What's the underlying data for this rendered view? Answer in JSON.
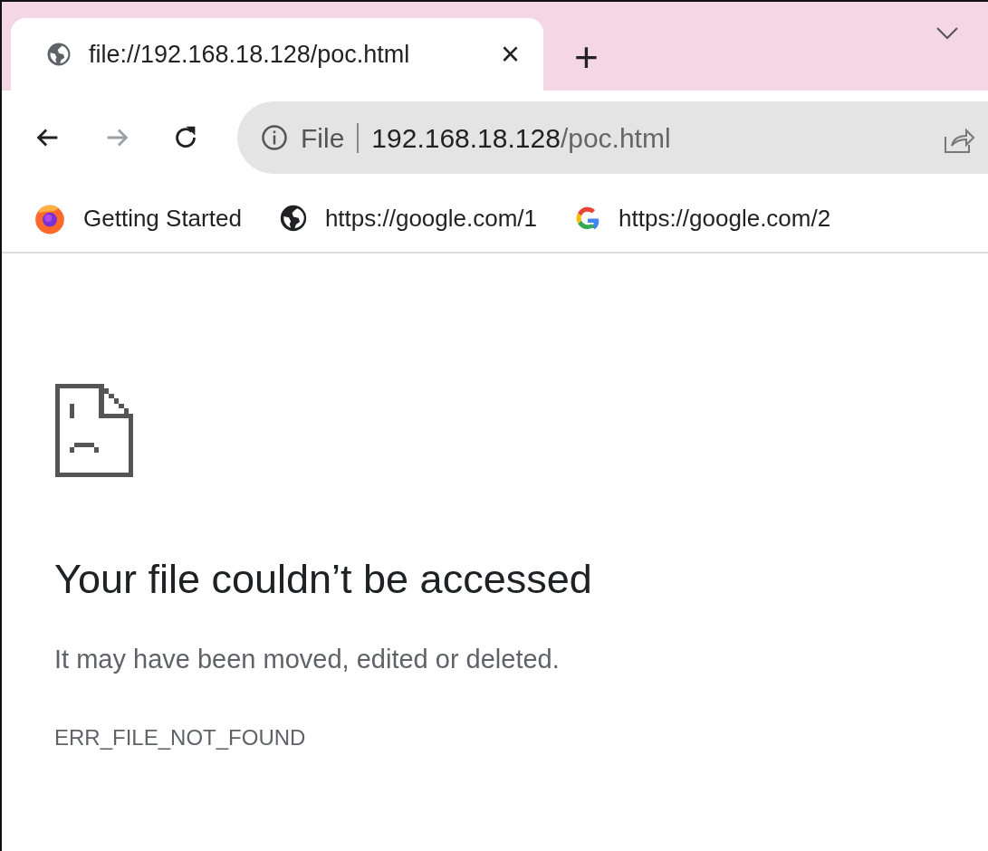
{
  "tabs": [
    {
      "title": "file://192.168.18.128/poc.html",
      "selected": true,
      "close": "×"
    }
  ],
  "new_tab": "+",
  "nav_buttons": [
    {
      "kind": "back",
      "disabled": false
    },
    {
      "kind": "forward",
      "disabled": true
    },
    {
      "kind": "reload",
      "disabled": false
    }
  ],
  "address_bar": {
    "scheme_label": "File",
    "host": "192.168.18.128",
    "path": "/poc.html"
  },
  "bookmarks": [
    {
      "kind": "firefox",
      "label": "Getting Started"
    },
    {
      "kind": "globe",
      "label": "https://google.com/1"
    },
    {
      "kind": "google",
      "label": "https://google.com/2"
    }
  ],
  "error_page": {
    "title": "Your file couldn’t be accessed",
    "message": "It may have been moved, edited or deleted.",
    "code": "ERR_FILE_NOT_FOUND"
  }
}
